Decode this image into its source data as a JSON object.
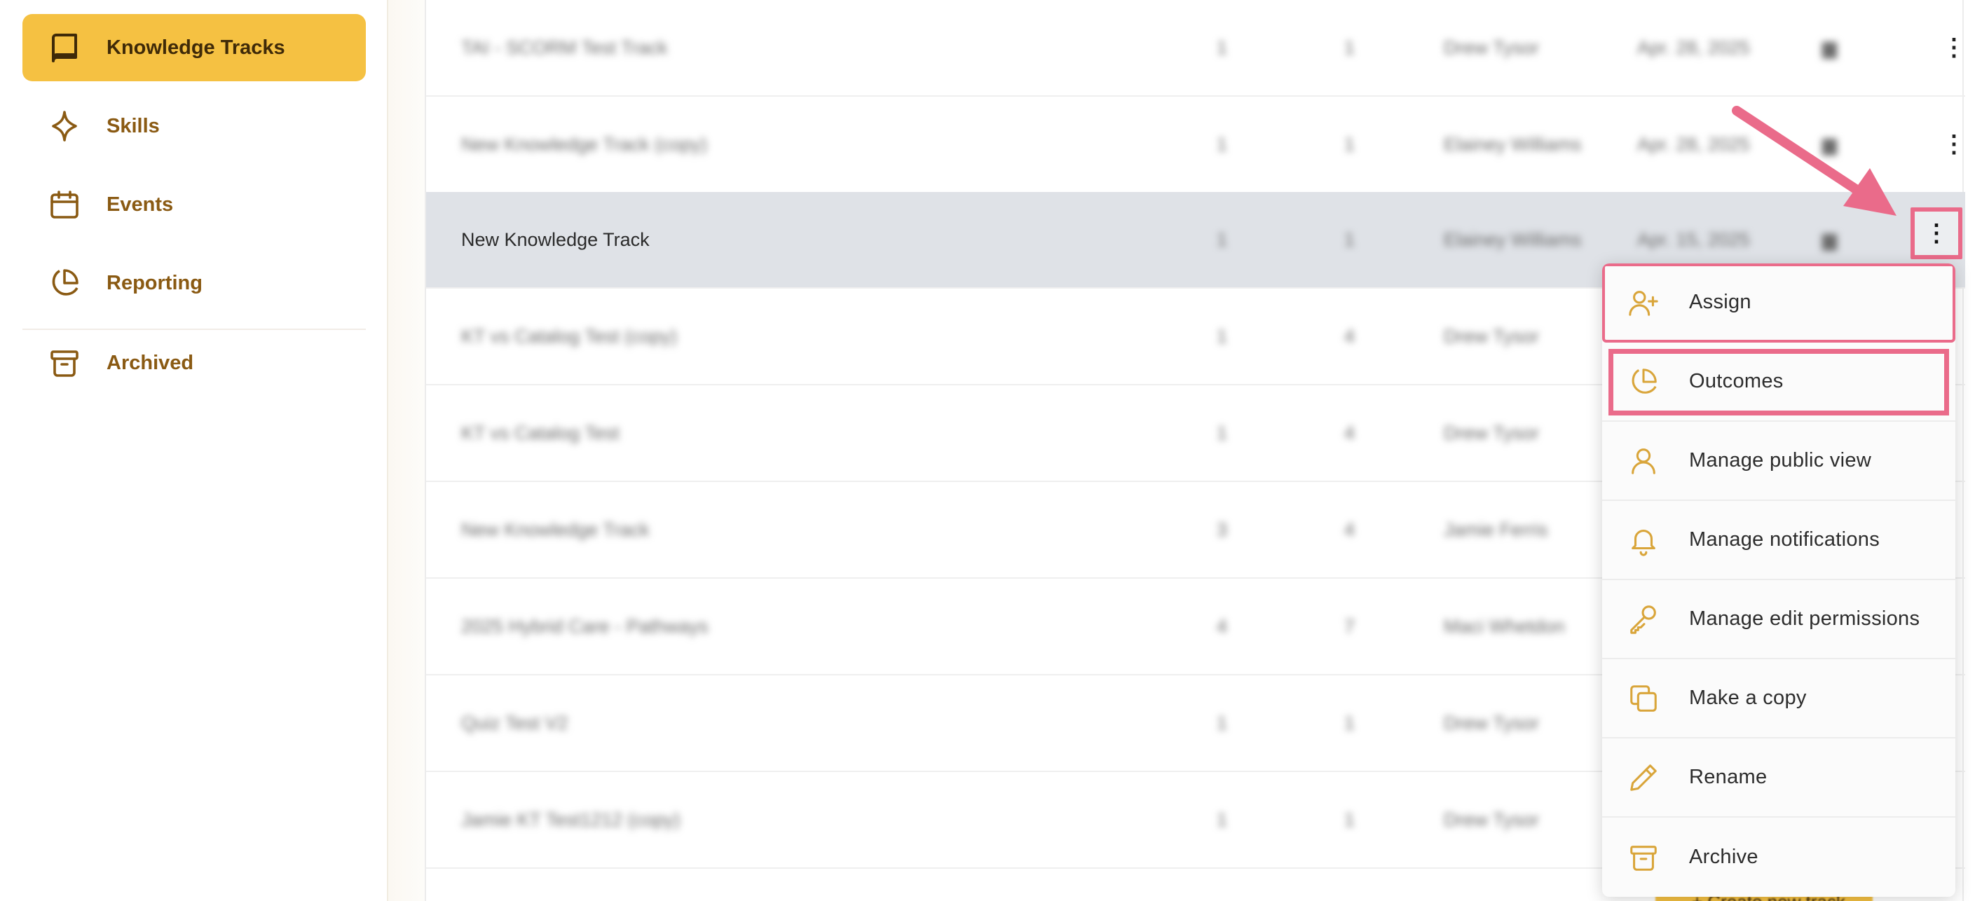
{
  "sidebar": {
    "items": [
      {
        "label": "Knowledge Tracks",
        "icon": "book-icon",
        "active": true
      },
      {
        "label": "Skills",
        "icon": "sparkle-icon",
        "active": false
      },
      {
        "label": "Events",
        "icon": "calendar-icon",
        "active": false
      },
      {
        "label": "Reporting",
        "icon": "pie-chart-icon",
        "active": false
      },
      {
        "label": "Archived",
        "icon": "archive-box-icon",
        "active": false
      }
    ]
  },
  "table": {
    "rows": [
      {
        "name": "TAI - SCORM Test Track",
        "a": "1",
        "b": "1",
        "owner": "Drew Tysor",
        "date": "Apr. 28, 2025"
      },
      {
        "name": "New Knowledge Track (copy)",
        "a": "1",
        "b": "1",
        "owner": "Elainey Williams",
        "date": "Apr. 28, 2025"
      },
      {
        "name": "New Knowledge Track",
        "a": "1",
        "b": "1",
        "owner": "Elainey Williams",
        "date": "Apr. 15, 2025"
      },
      {
        "name": "KT vs Catalog Test (copy)",
        "a": "1",
        "b": "4",
        "owner": "Drew Tysor",
        "date": ""
      },
      {
        "name": "KT vs Catalog Test",
        "a": "1",
        "b": "4",
        "owner": "Drew Tysor",
        "date": ""
      },
      {
        "name": "New Knowledge Track",
        "a": "3",
        "b": "4",
        "owner": "Jamie Ferris",
        "date": ""
      },
      {
        "name": "2025 Hybrid Care - Pathways",
        "a": "4",
        "b": "7",
        "owner": "Maci Whetdon",
        "date": ""
      },
      {
        "name": "Quiz Test V2",
        "a": "1",
        "b": "1",
        "owner": "Drew Tysor",
        "date": ""
      },
      {
        "name": "Jamie KT Test1212 (copy)",
        "a": "1",
        "b": "1",
        "owner": "Drew Tysor",
        "date": ""
      }
    ],
    "kebab": "⋮"
  },
  "menu": {
    "items": [
      {
        "label": "Assign",
        "icon": "user-plus-icon"
      },
      {
        "label": "Outcomes",
        "icon": "pie-chart-icon"
      },
      {
        "label": "Manage public view",
        "icon": "user-icon"
      },
      {
        "label": "Manage notifications",
        "icon": "bell-icon"
      },
      {
        "label": "Manage edit permissions",
        "icon": "key-icon"
      },
      {
        "label": "Make a copy",
        "icon": "copy-icon"
      },
      {
        "label": "Rename",
        "icon": "pencil-icon"
      },
      {
        "label": "Archive",
        "icon": "archive-box-icon"
      }
    ]
  },
  "footer": {
    "create_label": "+ Create new track"
  },
  "colors": {
    "accent": "#f5c142",
    "nav_text": "#8a5a13",
    "icon": "#d9a53a",
    "highlight": "#ea6b8a"
  }
}
